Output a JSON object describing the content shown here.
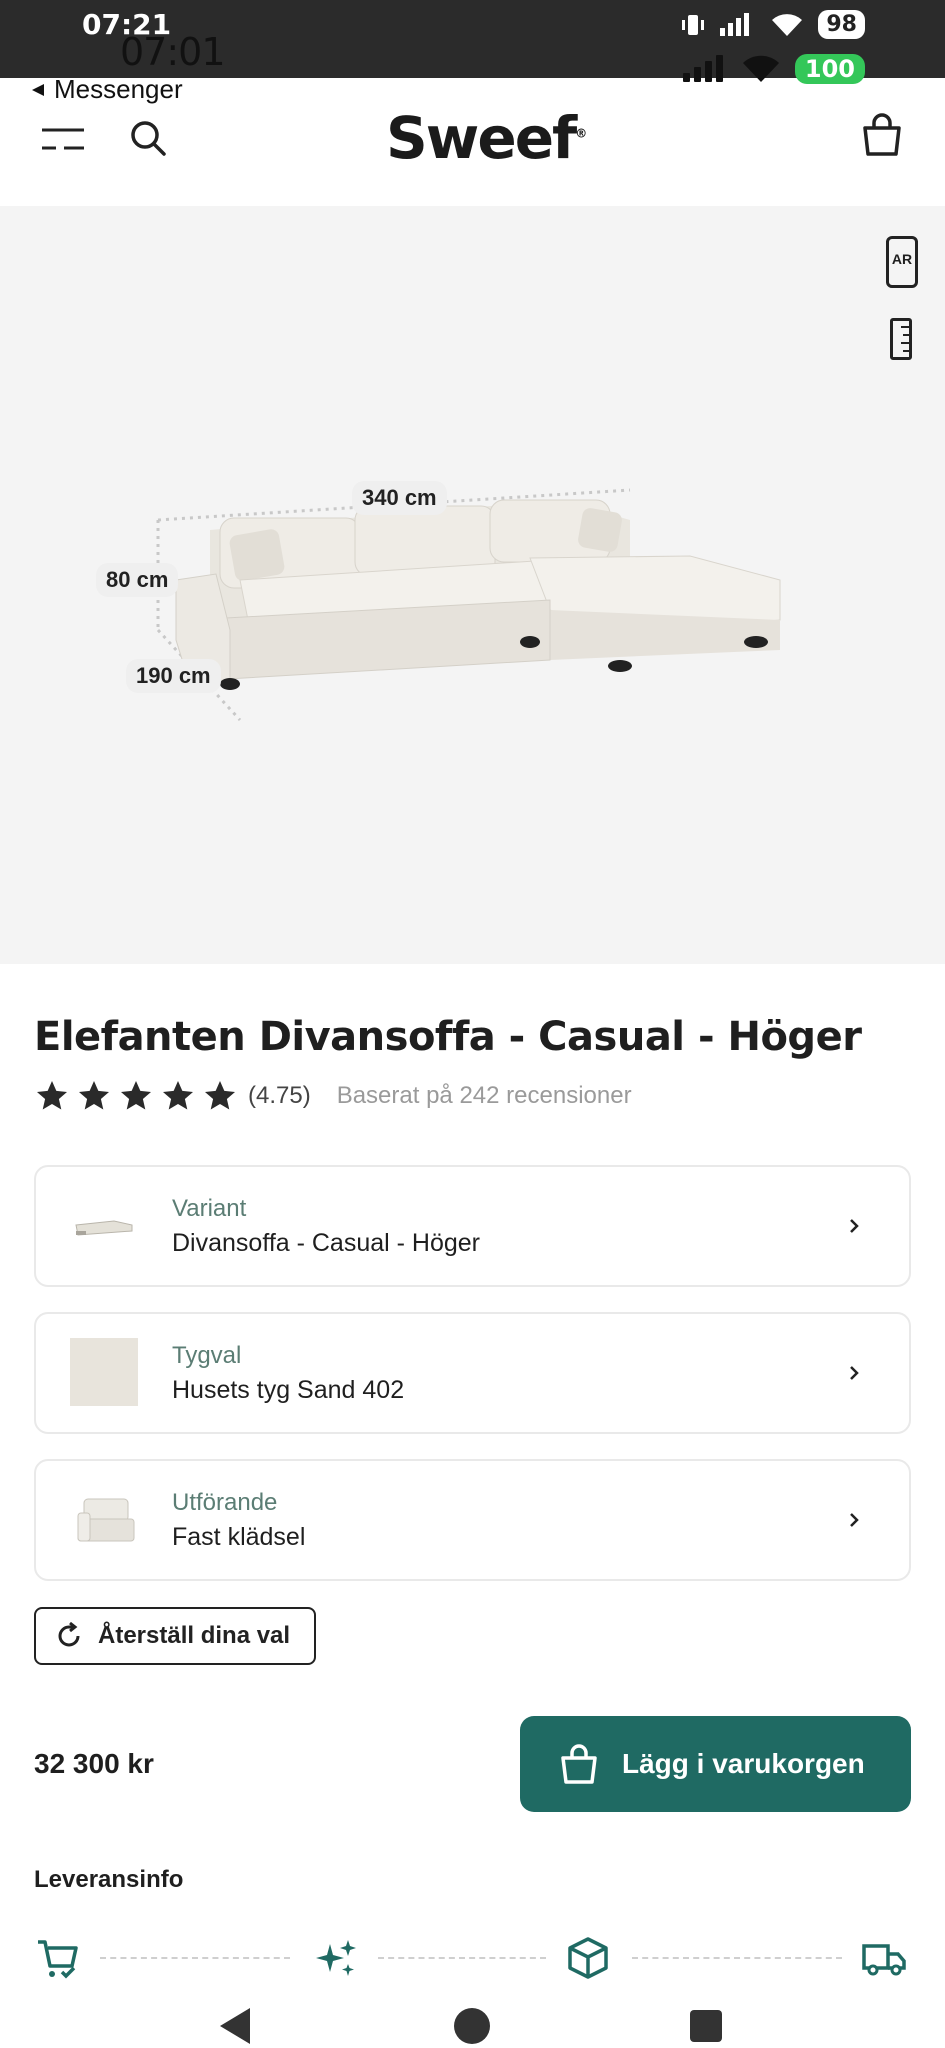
{
  "status_android": {
    "time": "07:21",
    "battery": "98"
  },
  "status_ios": {
    "time": "07:01",
    "battery": "100"
  },
  "back_label": "Messenger",
  "header": {
    "logo": "Sweef",
    "logo_mark": "®"
  },
  "hero": {
    "ar_label": "AR",
    "dimensions": {
      "width": "340 cm",
      "height": "80 cm",
      "depth": "190 cm"
    }
  },
  "product": {
    "title": "Elefanten Divansoffa - Casual - Höger",
    "rating": "(4.75)",
    "rating_value": 4.75,
    "rating_max": 5,
    "rating_text": "Baserat på 242 recensioner"
  },
  "options": [
    {
      "label": "Variant",
      "value": "Divansoffa - Casual - Höger"
    },
    {
      "label": "Tygval",
      "value": "Husets tyg Sand 402"
    },
    {
      "label": "Utförande",
      "value": "Fast klädsel"
    }
  ],
  "reset_label": "Återställ dina val",
  "price": "32 300 kr",
  "cart_label": "Lägg i varukorgen",
  "delivery_title": "Leveransinfo",
  "colors": {
    "accent": "#1f6a63",
    "label": "#5b7d74"
  }
}
